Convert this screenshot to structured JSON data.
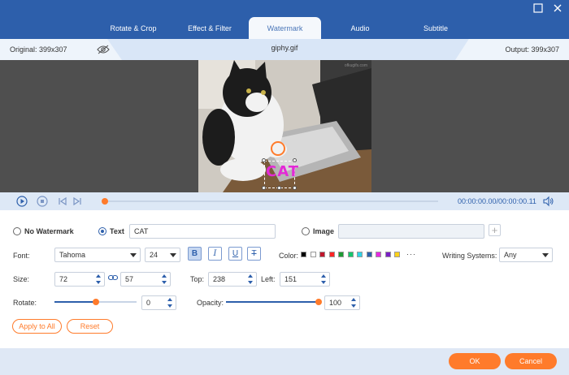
{
  "tabs": [
    {
      "label": "Rotate & Crop",
      "active": false
    },
    {
      "label": "Effect & Filter",
      "active": false
    },
    {
      "label": "Watermark",
      "active": true
    },
    {
      "label": "Audio",
      "active": false
    },
    {
      "label": "Subtitle",
      "active": false
    }
  ],
  "window_controls": {
    "minimize_icon": "minimize-icon",
    "close_icon": "close-icon"
  },
  "info": {
    "original": "Original: 399x307",
    "filename": "giphy.gif",
    "output": "Output: 399x307"
  },
  "preview": {
    "source_watermark": "ofkugifs.com",
    "watermark_text": "CAT",
    "watermark_color": "#e32ad6"
  },
  "player": {
    "time": "00:00:00.00/00:00:00.11",
    "progress": 0.0
  },
  "watermark": {
    "no_watermark_label": "No Watermark",
    "text_label": "Text",
    "text_value": "CAT",
    "image_label": "Image",
    "image_value": "",
    "mode": "text"
  },
  "font": {
    "label": "Font:",
    "family": "Tahoma",
    "size": "24",
    "bold": "B",
    "italic": "I",
    "underline": "U",
    "strike": "T",
    "bold_active": true,
    "color_label": "Color:",
    "colors": [
      "#000000",
      "#ffffff",
      "#c0162c",
      "#ff2525",
      "#1e9b33",
      "#15c76d",
      "#30d3e6",
      "#2d5fab",
      "#e52ae1",
      "#7a1fc4",
      "#ffd21a"
    ],
    "more": "···",
    "writing_label": "Writing Systems:",
    "writing_value": "Any"
  },
  "size": {
    "label": "Size:",
    "width": "72",
    "height": "57",
    "top_label": "Top:",
    "top": "238",
    "left_label": "Left:",
    "left": "151"
  },
  "rotate": {
    "label": "Rotate:",
    "value": "0",
    "position": 0.5
  },
  "opacity": {
    "label": "Opacity:",
    "value": "100",
    "position": 1.0
  },
  "buttons": {
    "apply_all": "Apply to All",
    "reset": "Reset",
    "ok": "OK",
    "cancel": "Cancel"
  },
  "colors": {
    "accent_blue": "#2d5fab",
    "accent_orange": "#ff7b2b"
  }
}
